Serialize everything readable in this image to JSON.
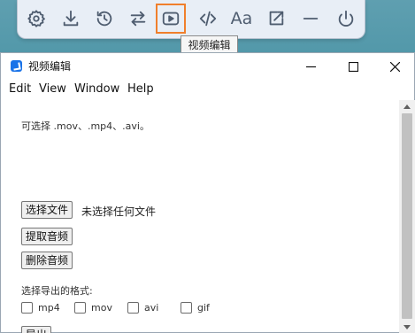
{
  "toolbar": {
    "buttons": [
      {
        "icon": "gear-icon"
      },
      {
        "icon": "download-icon"
      },
      {
        "icon": "history-icon"
      },
      {
        "icon": "swap-arrows-icon"
      },
      {
        "icon": "play-video-icon",
        "active": true
      },
      {
        "icon": "code-icon"
      },
      {
        "icon": "font-icon",
        "text": "Aa"
      },
      {
        "icon": "share-icon"
      },
      {
        "icon": "minus-icon"
      },
      {
        "icon": "power-icon"
      }
    ],
    "active_color": "#f07f2c",
    "tooltip": "视频编辑"
  },
  "window": {
    "title": "视频编辑",
    "menu": [
      "Edit",
      "View",
      "Window",
      "Help"
    ]
  },
  "content": {
    "formats_hint": "可选择 .mov、.mp4、.avi。",
    "choose_file_button": "选择文件",
    "no_file_text": "未选择任何文件",
    "extract_audio_button": "提取音频",
    "remove_audio_button": "删除音频",
    "export_format_label": "选择导出的格式:",
    "formats": [
      "mp4",
      "mov",
      "avi",
      "gif"
    ],
    "export_button": "导出"
  }
}
